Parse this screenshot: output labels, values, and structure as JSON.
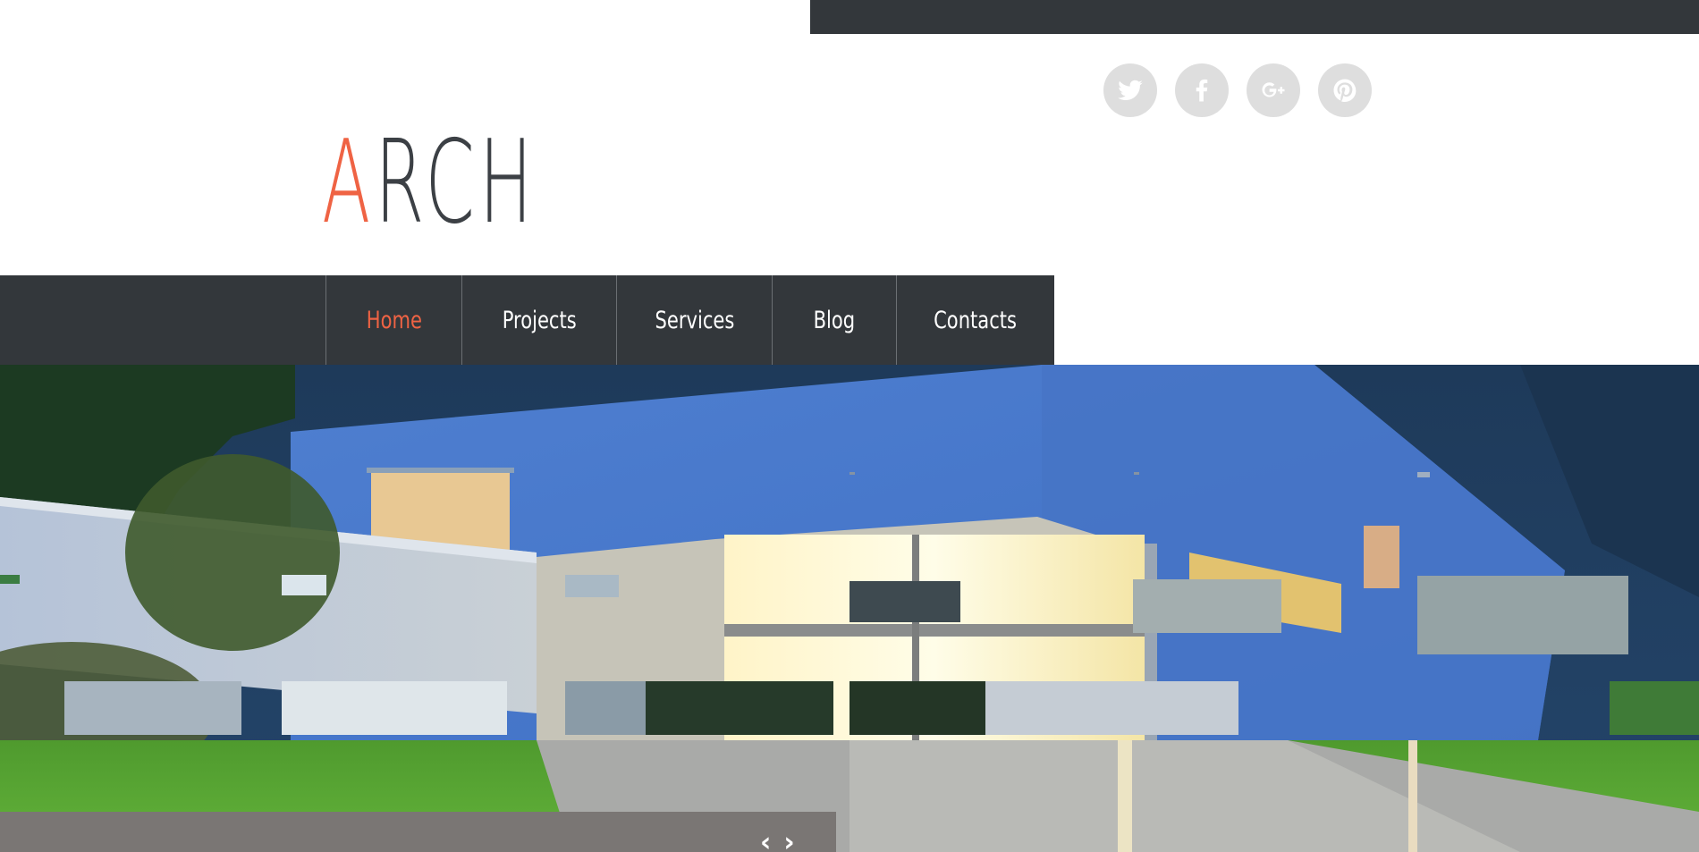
{
  "header": {
    "logo_accent": "A",
    "logo_rest": "RCH",
    "social": [
      {
        "name": "twitter-icon",
        "label": "Twitter"
      },
      {
        "name": "facebook-icon",
        "label": "Facebook"
      },
      {
        "name": "google-plus-icon",
        "label": "Google+"
      },
      {
        "name": "pinterest-icon",
        "label": "Pinterest"
      }
    ]
  },
  "nav": {
    "items": [
      {
        "label": "Home",
        "active": true
      },
      {
        "label": "Projects",
        "active": false
      },
      {
        "label": "Services",
        "active": false
      },
      {
        "label": "Blog",
        "active": false
      },
      {
        "label": "Contacts",
        "active": false
      }
    ]
  },
  "slider": {
    "prev": "‹",
    "next": "›"
  },
  "colors": {
    "accent": "#ef6344",
    "dark": "#33373b",
    "social_bg": "#dedede"
  }
}
